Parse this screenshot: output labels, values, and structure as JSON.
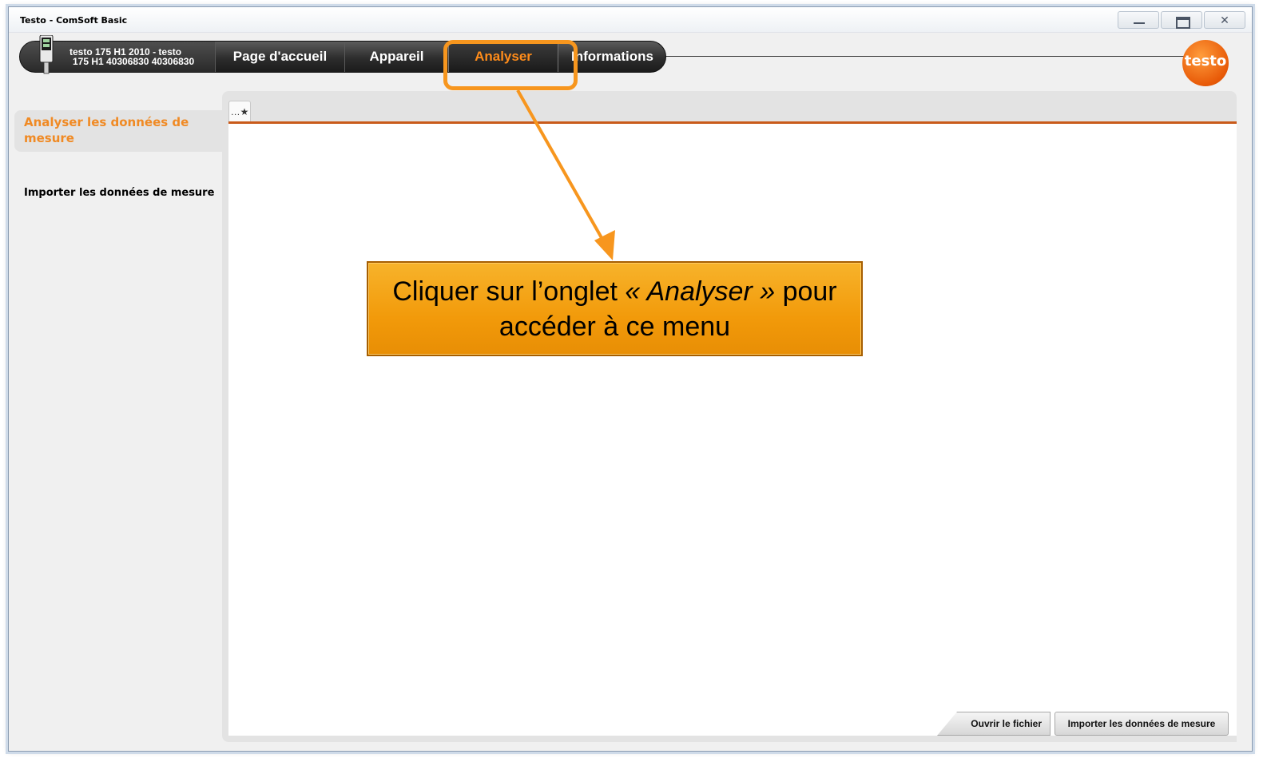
{
  "window": {
    "title": "Testo - ComSoft Basic",
    "controls": {
      "minimize": "",
      "maximize": "",
      "close": "✕"
    }
  },
  "nav": {
    "device_line1": "testo 175 H1 2010 - testo",
    "device_line2": "175 H1 40306830 40306830",
    "tabs": [
      {
        "label": "Page d'accueil",
        "active": false
      },
      {
        "label": "Appareil",
        "active": false
      },
      {
        "label": "Analyser",
        "active": true
      },
      {
        "label": "Informations",
        "active": false
      }
    ],
    "logo": "testo"
  },
  "sidebar": {
    "items": [
      {
        "label": "Analyser les données de mesure",
        "active": true
      },
      {
        "label": "Importer les données de mesure",
        "active": false
      }
    ]
  },
  "content": {
    "tab_icon": "…★",
    "buttons": {
      "open_file": "Ouvrir le fichier",
      "import_data": "Importer les données de mesure"
    }
  },
  "annotation": {
    "text_before": "Cliquer sur l’onglet ",
    "text_italic": "« Analyser »",
    "text_after": " pour accéder à ce menu"
  },
  "colors": {
    "accent": "#f7961e",
    "active_tab_text": "#ff8c1a",
    "content_border": "#c95a1a",
    "nav_bg": "#2d2d2d"
  }
}
